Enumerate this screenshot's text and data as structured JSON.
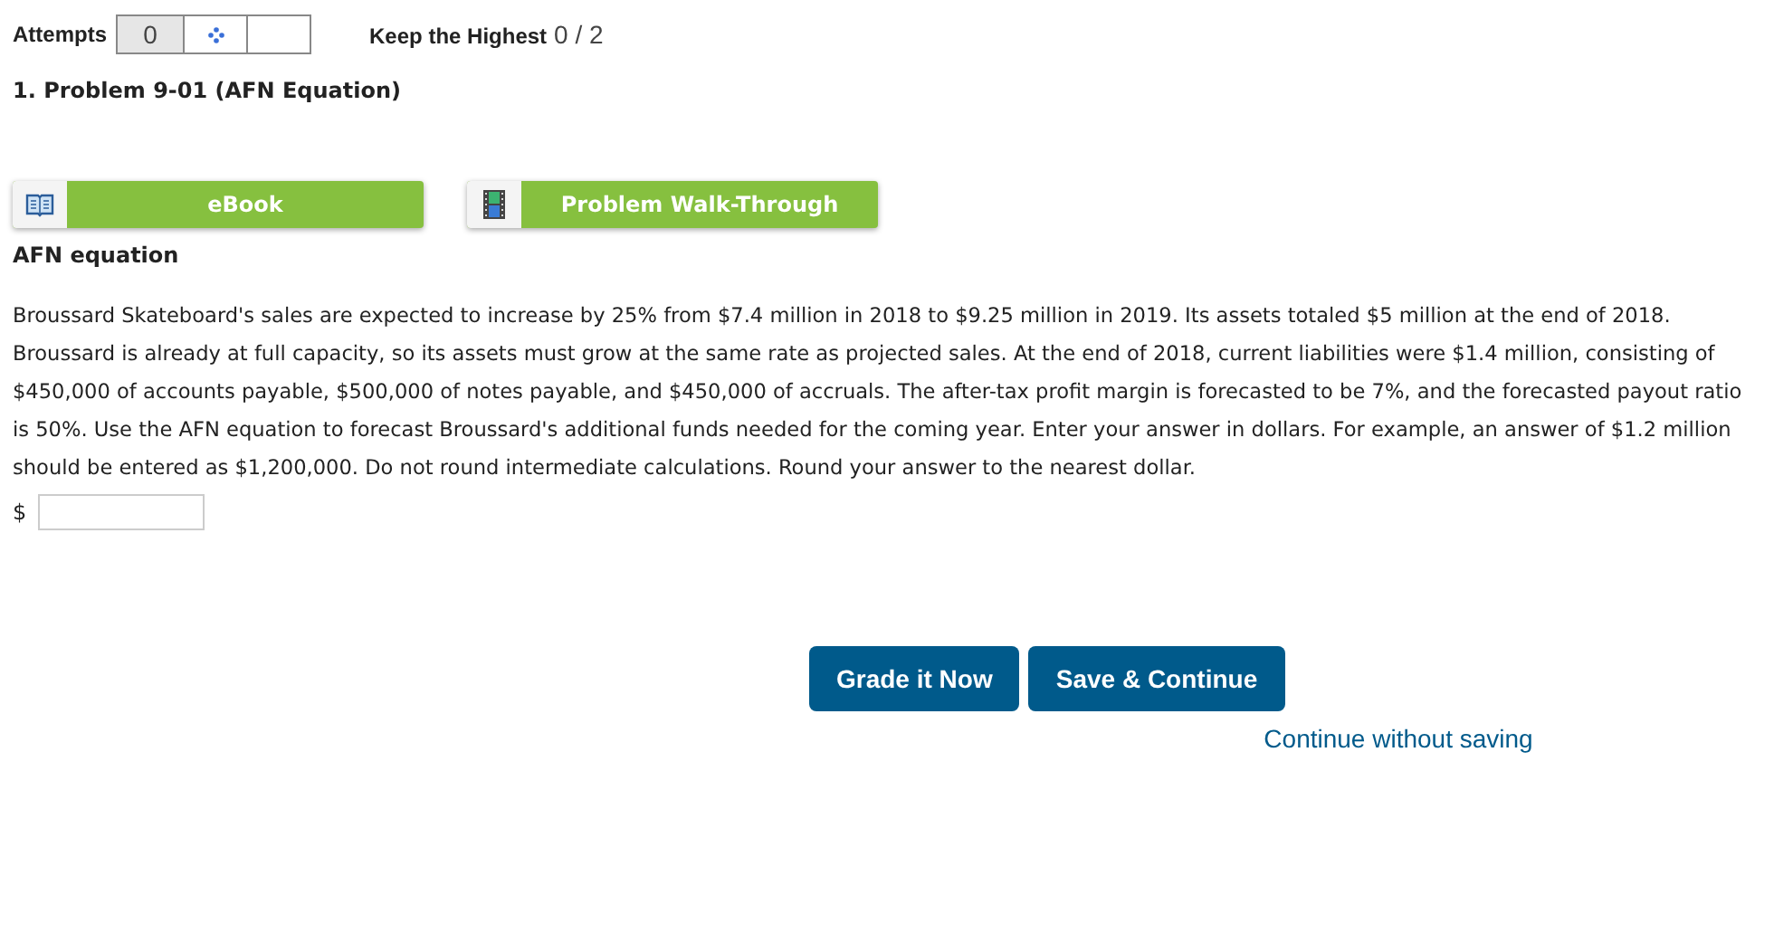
{
  "attempts": {
    "label": "Attempts",
    "count": "0"
  },
  "keep_highest": {
    "label": "Keep the Highest",
    "score": "0 / 2"
  },
  "problem_title": "1.  Problem 9-01 (AFN Equation)",
  "resource_buttons": [
    {
      "kind": "book",
      "label": "eBook"
    },
    {
      "kind": "film",
      "label": "Problem Walk-Through"
    }
  ],
  "section_title": "AFN equation",
  "paragraphs": [
    "Broussard Skateboard's sales are expected to increase by 25% from $7.4 million in 2018 to $9.25 million in 2019. Its assets totaled $5 million at the end of 2018.",
    "Broussard is already at full capacity, so its assets must grow at the same rate as projected sales. At the end of 2018, current liabilities were $1.4 million, consisting of $450,000 of accounts payable, $500,000 of notes payable, and $450,000 of accruals. The after-tax profit margin is forecasted to be 7%, and the forecasted payout ratio is 50%. Use the AFN equation to forecast Broussard's additional funds needed for the coming year. Enter your answer in dollars. For example, an answer of $1.2 million should be entered as $1,200,000. Do not round intermediate calculations. Round your answer to the nearest dollar."
  ],
  "answer": {
    "prefix": "$"
  },
  "actions": [
    "Grade it Now",
    "Save & Continue"
  ],
  "continue_link": "Continue without saving"
}
